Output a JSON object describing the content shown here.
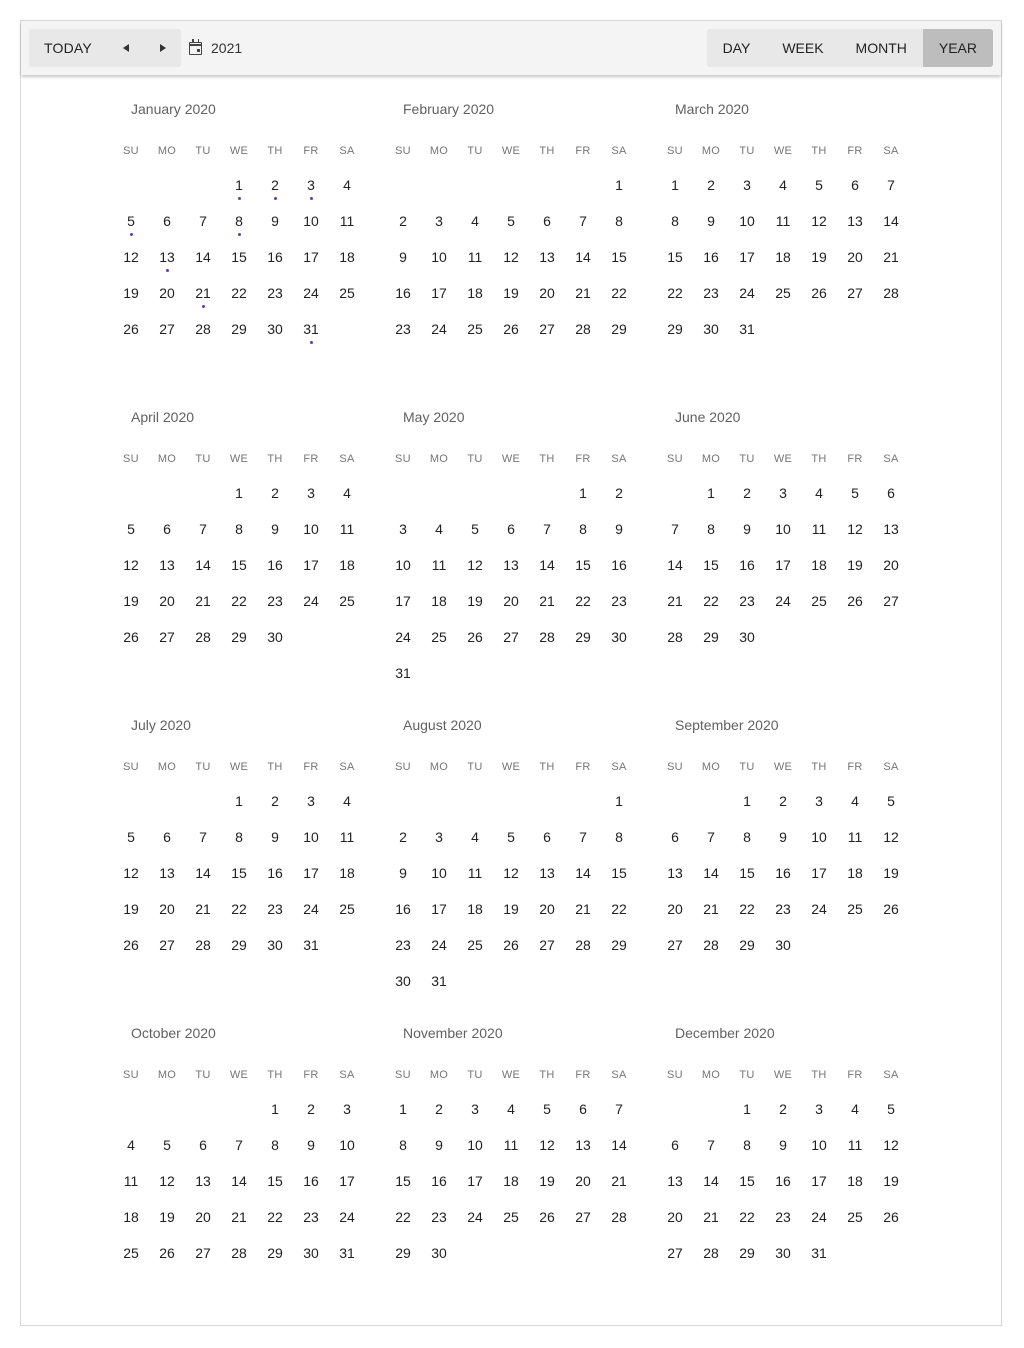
{
  "toolbar": {
    "today_label": "TODAY",
    "prev_icon": "triangle-left-icon",
    "next_icon": "triangle-right-icon",
    "calendar_icon": "calendar-icon",
    "year": "2021",
    "views": [
      "DAY",
      "WEEK",
      "MONTH",
      "YEAR"
    ],
    "active_view": "YEAR"
  },
  "weekday_labels": [
    "SU",
    "MO",
    "TU",
    "WE",
    "TH",
    "FR",
    "SA"
  ],
  "event_dot_color": "#5c3ea3",
  "active_view_color": "#bdbdbd",
  "months": [
    {
      "title": "January 2020",
      "first_weekday": 3,
      "days": 31,
      "event_days": [
        1,
        2,
        3,
        5,
        8,
        13,
        21,
        31
      ]
    },
    {
      "title": "February 2020",
      "first_weekday": 6,
      "days": 29,
      "event_days": []
    },
    {
      "title": "March 2020",
      "first_weekday": 0,
      "days": 31,
      "event_days": []
    },
    {
      "title": "April 2020",
      "first_weekday": 3,
      "days": 30,
      "event_days": []
    },
    {
      "title": "May 2020",
      "first_weekday": 5,
      "days": 31,
      "event_days": []
    },
    {
      "title": "June 2020",
      "first_weekday": 1,
      "days": 30,
      "event_days": []
    },
    {
      "title": "July 2020",
      "first_weekday": 3,
      "days": 31,
      "event_days": []
    },
    {
      "title": "August 2020",
      "first_weekday": 6,
      "days": 31,
      "event_days": []
    },
    {
      "title": "September 2020",
      "first_weekday": 2,
      "days": 30,
      "event_days": []
    },
    {
      "title": "October 2020",
      "first_weekday": 4,
      "days": 31,
      "event_days": []
    },
    {
      "title": "November 2020",
      "first_weekday": 0,
      "days": 30,
      "event_days": []
    },
    {
      "title": "December 2020",
      "first_weekday": 2,
      "days": 31,
      "event_days": []
    }
  ]
}
